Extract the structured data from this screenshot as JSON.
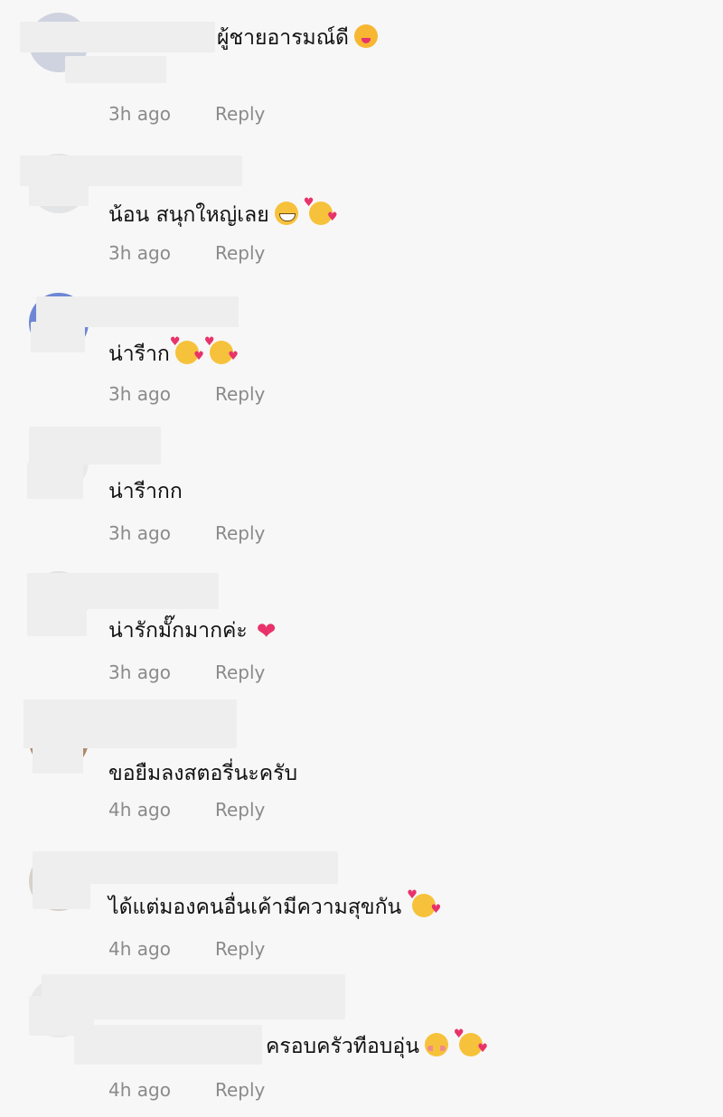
{
  "comments": [
    {
      "text": "ผู้ชายอารมณ์ดี",
      "time": "3h ago",
      "reply": "Reply",
      "emojis": [
        "wink-emoji"
      ]
    },
    {
      "text": "น้อน สนุกใหญ่เลย",
      "time": "3h ago",
      "reply": "Reply",
      "emojis": [
        "grin-emoji",
        "smiling-face-with-hearts-emoji"
      ]
    },
    {
      "text": "น่ารีาก",
      "time": "3h ago",
      "reply": "Reply",
      "emojis": [
        "smiling-face-with-hearts-emoji",
        "smiling-face-with-hearts-emoji"
      ]
    },
    {
      "text": "น่ารีากก",
      "time": "3h ago",
      "reply": "Reply",
      "emojis": []
    },
    {
      "text": "น่ารักมั๊กมากค่ะ",
      "time": "3h ago",
      "reply": "Reply",
      "emojis": [
        "sparkling-heart-emoji"
      ]
    },
    {
      "text": "ขอยืมลงสตอรี่นะครับ",
      "time": "4h ago",
      "reply": "Reply",
      "emojis": []
    },
    {
      "text": "ได้แต่มองคนอื่นเค้ามีความสุขกัน",
      "time": "4h ago",
      "reply": "Reply",
      "emojis": [
        "smiling-face-with-hearts-emoji"
      ]
    },
    {
      "text": "ครอบครัวทีอบอุ่น",
      "time": "4h ago",
      "reply": "Reply",
      "emojis": [
        "flushed-emoji",
        "smiling-face-with-hearts-emoji"
      ]
    }
  ],
  "colors": {
    "background": "#f7f7f7",
    "text": "#111111",
    "meta": "#8a8a8a"
  }
}
